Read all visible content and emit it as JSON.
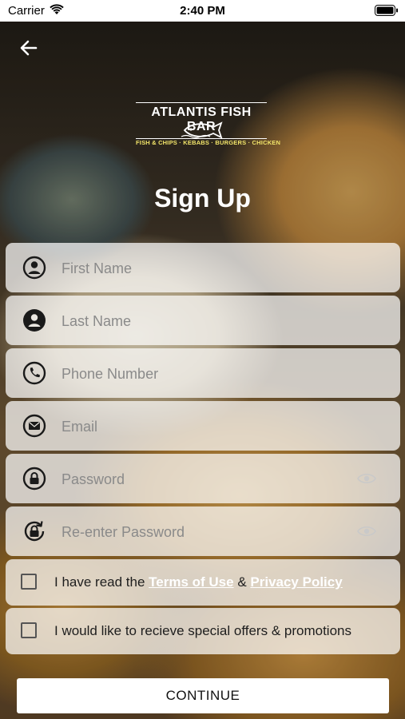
{
  "status_bar": {
    "carrier": "Carrier",
    "time": "2:40 PM"
  },
  "logo": {
    "title": "ATLANTIS FISH BAR",
    "tagline": "FISH & CHIPS · KEBABS · BURGERS · CHICKEN",
    "tagline_color": "#f3e56a"
  },
  "page_title": "Sign Up",
  "fields": [
    {
      "placeholder": "First Name",
      "value": "",
      "icon": "person-outline-icon"
    },
    {
      "placeholder": "Last Name",
      "value": "",
      "icon": "person-filled-icon"
    },
    {
      "placeholder": "Phone Number",
      "value": "",
      "icon": "phone-icon"
    },
    {
      "placeholder": "Email",
      "value": "",
      "icon": "envelope-icon"
    },
    {
      "placeholder": "Password",
      "value": "",
      "icon": "lock-icon"
    },
    {
      "placeholder": "Re-enter Password",
      "value": "",
      "icon": "lock-rotate-icon"
    }
  ],
  "terms": {
    "prefix": "I have read the ",
    "terms_link": "Terms of Use",
    "amp": " & ",
    "privacy_link": "Privacy Policy",
    "checked": false
  },
  "offers": {
    "label": "I would like to recieve special offers & promotions",
    "checked": false
  },
  "continue_label": "CONTINUE"
}
